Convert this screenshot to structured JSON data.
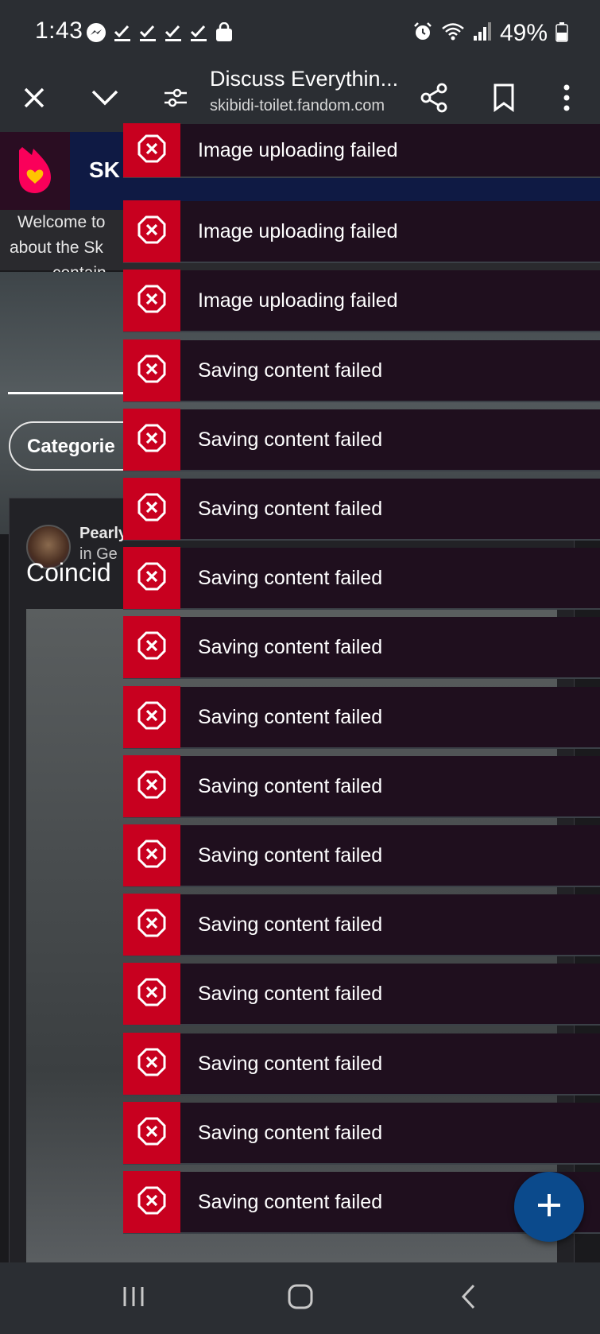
{
  "status_bar": {
    "time": "1:43",
    "battery": "49%",
    "left_icons": [
      "messenger-icon",
      "check-icon",
      "check-icon",
      "check-icon",
      "check-icon",
      "shopping-bag-icon"
    ],
    "right_icons": [
      "alarm-icon",
      "wifi-icon",
      "signal-icon",
      "battery-icon"
    ]
  },
  "toolbar": {
    "title": "Discuss Everythin...",
    "url": "skibidi-toilet.fandom.com",
    "icons": [
      "close-icon",
      "chevron-down-icon",
      "tune-icon",
      "share-icon",
      "bookmark-icon",
      "more-vert-icon"
    ]
  },
  "page": {
    "wiki_name": "SK",
    "welcome_line1": "Welcome to",
    "welcome_line2": "about the Sk",
    "welcome_line3": "contain",
    "categories_label": "Categorie",
    "post": {
      "author": "PearlyTomes",
      "dot": "•",
      "in_category": "in Ge",
      "title": "Coincid"
    }
  },
  "toasts": [
    {
      "message": "Image uploading failed"
    },
    {
      "message": "Image uploading failed"
    },
    {
      "message": "Image uploading failed"
    },
    {
      "message": "Saving content failed"
    },
    {
      "message": "Saving content failed"
    },
    {
      "message": "Saving content failed"
    },
    {
      "message": "Saving content failed"
    },
    {
      "message": "Saving content failed"
    },
    {
      "message": "Saving content failed"
    },
    {
      "message": "Saving content failed"
    },
    {
      "message": "Saving content failed"
    },
    {
      "message": "Saving content failed"
    },
    {
      "message": "Saving content failed"
    },
    {
      "message": "Saving content failed"
    },
    {
      "message": "Saving content failed"
    },
    {
      "message": "Saving content failed"
    }
  ],
  "colors": {
    "toast_error": "#c8001f",
    "toast_bg": "#1f0f1e",
    "fab": "#0b4a8c",
    "fandom_logo": "#fa005a"
  }
}
